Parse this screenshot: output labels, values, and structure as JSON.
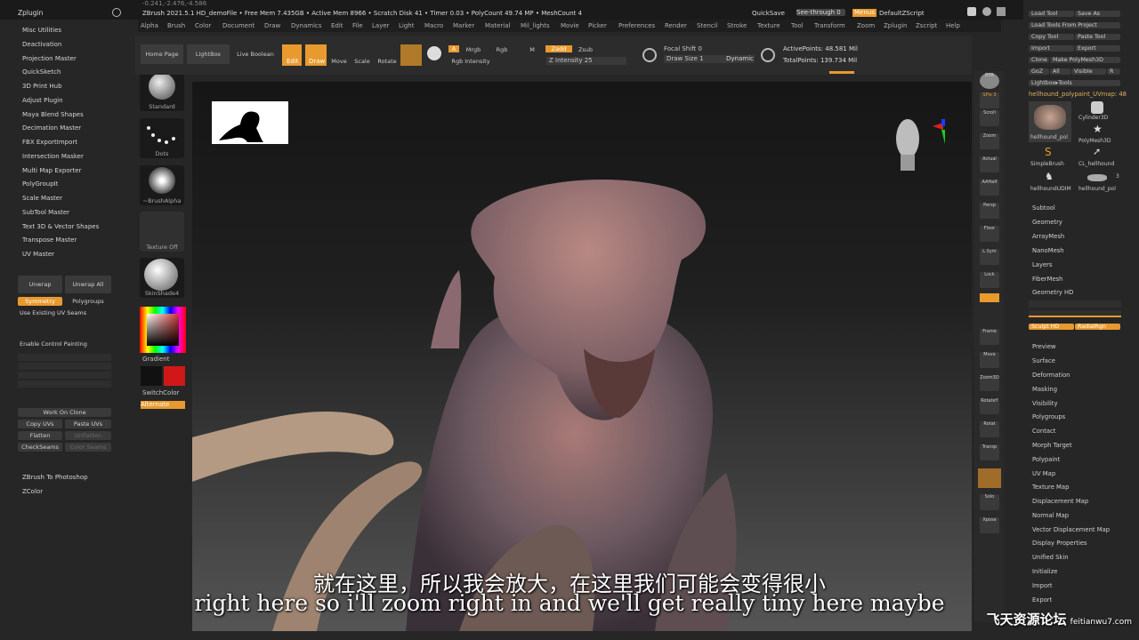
{
  "titlebar": {
    "app_title": "ZBrush 2021.5.1 HD_demoFile  • Free Mem 7.435GB • Active Mem 8966 • Scratch Disk 41 • Timer 0.03 • PolyCount 49.74 MP • MeshCount 4",
    "zplugin": "Zplugin",
    "quicksave": "QuickSave",
    "seethrough": "See-through 0",
    "menus": "Menus",
    "defaultzscript": "DefaultZScript",
    "coords": "-0.241,-2.476,-4.586"
  },
  "menubar": [
    "Alpha",
    "Brush",
    "Color",
    "Document",
    "Draw",
    "Dynamics",
    "Edit",
    "File",
    "Layer",
    "Light",
    "Macro",
    "Marker",
    "Material",
    "Mil_lights",
    "Movie",
    "Picker",
    "Preferences",
    "Render",
    "Stencil",
    "Stroke",
    "Texture",
    "Tool",
    "Transform",
    "Zoom",
    "Zplugin",
    "Zscript",
    "Help"
  ],
  "left_plugins": [
    "Misc Utilities",
    "Deactivation",
    "Projection Master",
    "QuickSketch",
    "3D Print Hub",
    "Adjust Plugin",
    "Maya Blend Shapes",
    "Decimation Master",
    "FBX ExportImport",
    "Intersection Masker",
    "Multi Map Exporter",
    "PolyGroupIt",
    "Scale Master",
    "SubTool Master",
    "Text 3D & Vector Shapes",
    "Transpose Master",
    "UV Master"
  ],
  "uv_master": {
    "unwrap": "Unwrap",
    "unwrap_all": "Unwrap All",
    "symmetry": "Symmetry",
    "polygroups": "Polygroups",
    "use_existing": "Use Existing UV Seams",
    "enable_cp": "Enable Control Painting",
    "work_on_clone": "Work On Clone",
    "copy_uvs": "Copy UVs",
    "paste_uvs": "Paste UVs",
    "flatten": "Flatten",
    "unflatten": "Unflatten",
    "checkseams": "CheckSeams",
    "color_seams": "Color Seams"
  },
  "left_bottom": [
    "ZBrush To Photoshop",
    "ZColor"
  ],
  "brush_column": {
    "standard": "Standard",
    "dots": "Dots",
    "alpha": "~BrushAlpha",
    "texture": "Texture Off",
    "material": "SkinShade4",
    "gradient": "Gradient",
    "switchcolor": "SwitchColor",
    "alternate": "Alternate"
  },
  "shelf": {
    "home_page": "Home Page",
    "lightbox": "LightBox",
    "live_boolean": "Live Boolean",
    "edit": "Edit",
    "draw": "Draw",
    "move": "Move",
    "scale": "Scale",
    "rotate": "Rotate",
    "a": "A",
    "mrgb": "Mrgb",
    "rgb": "Rgb",
    "m": "M",
    "zadd": "Zadd",
    "zsub": "Zsub",
    "rgb_intensity": "Rgb Intensity",
    "z_intensity": "Z Intensity 25",
    "focal_shift": "Focal Shift 0",
    "draw_size": "Draw Size 1",
    "dynamic": "Dynamic",
    "active_points": "ActivePoints: 48.581 Mil",
    "total_points": "TotalPoints: 139.734 Mil"
  },
  "right_shelf": [
    "BPR",
    "SPix 3",
    "Scroll",
    "Zoom",
    "Actual",
    "AAHalf",
    "Persp",
    "Floor",
    "L.Sym",
    "Lock",
    "Frame",
    "Move",
    "Zoom3D",
    "RotateY",
    "Rotat",
    "Transp",
    "Solo",
    "Xpose"
  ],
  "right_panel": {
    "load_tool": "Load Tool",
    "save_as": "Save As",
    "load_from_project": "Load Tools From Project",
    "copy_tool": "Copy Tool",
    "paste_tool": "Paste Tool",
    "import": "Import",
    "export": "Export",
    "clone": "Clone",
    "make_polymesh": "Make PolyMesh3D",
    "goz": "GoZ",
    "all": "All",
    "visible": "Visible",
    "r": "R",
    "lightbox_tools": "Lightbox▸Tools",
    "current_tool": "hellhound_polypaint_UVmap: 48",
    "tools": [
      "hellhound_pol",
      "Cylinder3D",
      "PolyMesh3D",
      "SimpleBrush",
      "CL_hellhound",
      "hellhoundUDIM",
      "hellhound_pol"
    ],
    "tool_count": "3",
    "sections_top": [
      "Subtool",
      "Geometry",
      "ArrayMesh",
      "NanoMesh",
      "Layers",
      "FiberMesh",
      "Geometry HD"
    ],
    "sculpt_hd": "Sculpt HD",
    "radialhgr": "RadialRgn",
    "sections": [
      "Preview",
      "Surface",
      "Deformation",
      "Masking",
      "Visibility",
      "Polygroups",
      "Contact",
      "Morph Target",
      "Polypaint",
      "UV Map",
      "Texture Map",
      "Displacement Map",
      "Normal Map",
      "Vector Displacement Map",
      "Display Properties",
      "Unified Skin",
      "Initialize",
      "Import",
      "Export"
    ]
  },
  "subtitles": {
    "chinese": "就在这里，所以我会放大，在这里我们可能会变得很小",
    "english": "right here so i'll zoom right in and we'll get really tiny here maybe"
  },
  "watermark": {
    "text": "飞天资源论坛",
    "url": "feitianwu7.com"
  }
}
